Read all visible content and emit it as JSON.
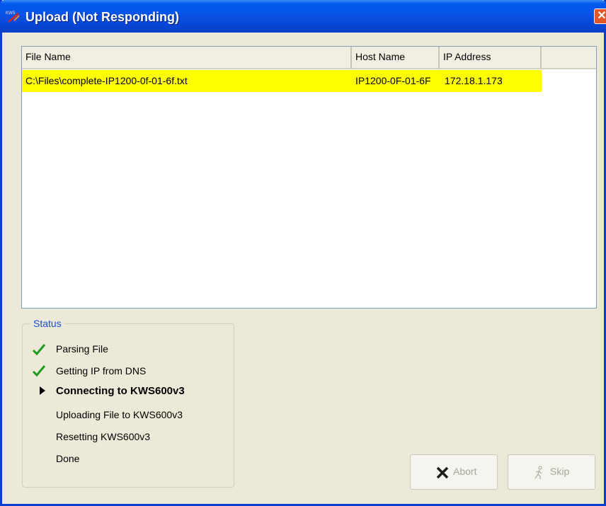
{
  "window": {
    "title": "Upload (Not Responding)",
    "close_glyph": "✕",
    "icon": "kws-app-icon"
  },
  "table": {
    "headers": [
      "File Name",
      "Host Name",
      "IP Address"
    ],
    "rows": [
      {
        "file_name": "C:\\Files\\complete-IP1200-0f-01-6f.txt",
        "host_name": "IP1200-0F-01-6F",
        "ip_address": "172.18.1.173",
        "highlight": "#ffff00"
      }
    ]
  },
  "status": {
    "label": "Status",
    "steps": [
      {
        "label": "Parsing File",
        "state": "done",
        "icon": "checkmark-icon"
      },
      {
        "label": "Getting IP from DNS",
        "state": "done",
        "icon": "checkmark-icon"
      },
      {
        "label": "Connecting to KWS600v3",
        "state": "active",
        "icon": "arrow-right-icon"
      },
      {
        "label": "Uploading File to KWS600v3",
        "state": "pending"
      },
      {
        "label": "Resetting KWS600v3",
        "state": "pending"
      },
      {
        "label": "Done",
        "state": "pending"
      }
    ]
  },
  "buttons": {
    "abort": {
      "label": "Abort",
      "icon": "x-icon",
      "enabled": false
    },
    "skip": {
      "label": "Skip",
      "icon": "walking-person-icon",
      "enabled": false
    }
  },
  "colors": {
    "titlebar": "#0a55e8",
    "check": "#1f9a1f",
    "status_label": "#1b50ce",
    "row_highlight": "#ffff00"
  }
}
